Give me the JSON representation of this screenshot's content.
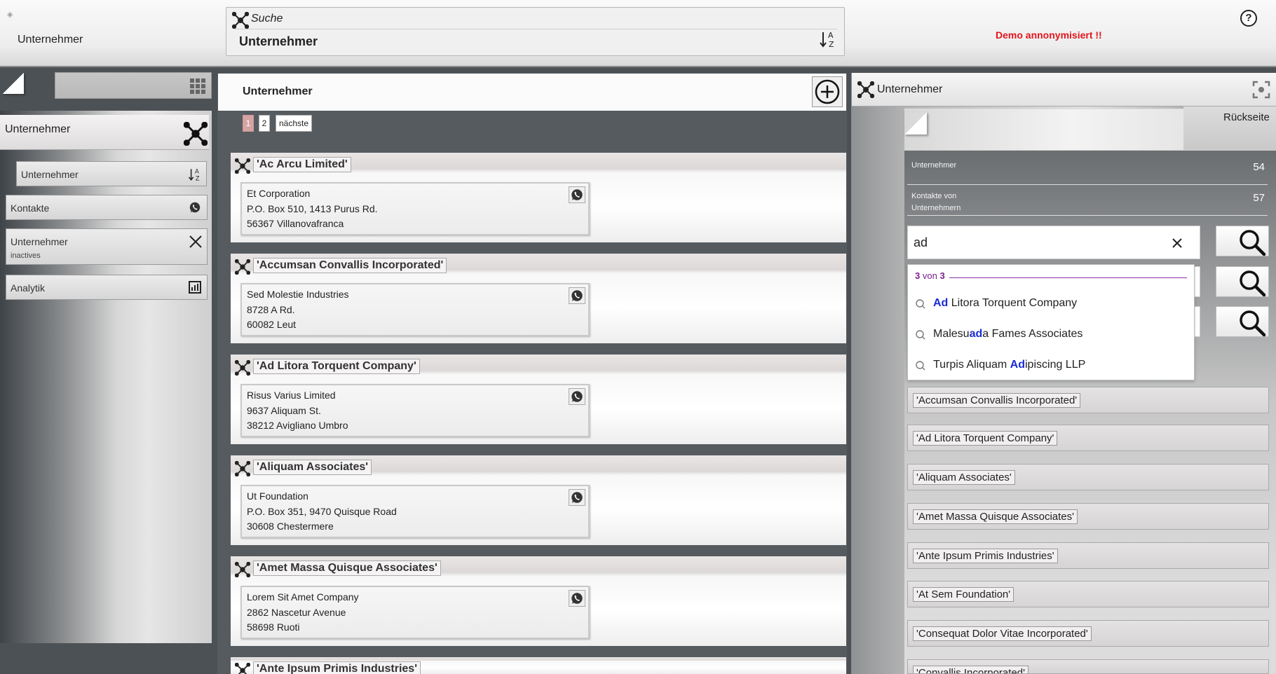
{
  "header": {
    "context_label": "Unternehmer",
    "search_label": "Suche",
    "search_value": "Unternehmer",
    "demo_notice": "Demo annonymisiert !!",
    "help_label": "?"
  },
  "sidebar": {
    "title": "Unternehmer",
    "items": [
      {
        "label": "Unternehmer",
        "sub": "",
        "icon": "sort-az-icon"
      },
      {
        "label": "Kontakte",
        "sub": "",
        "icon": "whatsapp-icon"
      },
      {
        "label": "Unternehmer",
        "sub": "inactives",
        "icon": "close-icon"
      },
      {
        "label": "Analytik",
        "sub": "",
        "icon": "analytics-icon"
      }
    ]
  },
  "main": {
    "title": "Unternehmer",
    "pager": [
      "1",
      "2",
      "nächste"
    ],
    "cards": [
      {
        "title": "'Ac Arcu Limited'",
        "lines": [
          "Et Corporation",
          "P.O. Box 510, 1413 Purus Rd.",
          "56367 Villanovafranca"
        ]
      },
      {
        "title": "'Accumsan Convallis Incorporated'",
        "lines": [
          "Sed Molestie Industries",
          "8728 A Rd.",
          "60082 Leut"
        ]
      },
      {
        "title": "'Ad Litora Torquent Company'",
        "lines": [
          "Risus Varius Limited",
          "9637 Aliquam St.",
          "38212 Avigliano Umbro"
        ]
      },
      {
        "title": "'Aliquam Associates'",
        "lines": [
          "Ut Foundation",
          "P.O. Box 351, 9470 Quisque Road",
          "30608 Chestermere"
        ]
      },
      {
        "title": "'Amet Massa Quisque Associates'",
        "lines": [
          "Lorem Sit Amet Company",
          "2862 Nascetur Avenue",
          "58698 Ruoti"
        ]
      },
      {
        "title": "'Ante Ipsum Primis Industries'",
        "lines": [
          "",
          "",
          ""
        ]
      }
    ]
  },
  "right": {
    "title": "Unternehmer",
    "back_label": "Rückseite",
    "stats": [
      {
        "label": "Unternehmer",
        "value": "54"
      },
      {
        "label": "Kontakte von Unternehmern",
        "value": "57"
      }
    ],
    "search_value": "ad",
    "dropdown": {
      "count_current": "3",
      "count_of": "von",
      "count_total": "3",
      "items": [
        {
          "pre": "",
          "hl": "Ad",
          "post": " Litora Torquent Company"
        },
        {
          "pre": "Malesu",
          "hl": "ad",
          "post": "a Fames Associates"
        },
        {
          "pre": "Turpis Aliquam ",
          "hl": "Ad",
          "post": "ipiscing LLP"
        }
      ]
    },
    "list": [
      "'Accumsan Convallis Incorporated'",
      "'Ad Litora Torquent Company'",
      "'Aliquam Associates'",
      "'Amet Massa Quisque Associates'",
      "'Ante Ipsum Primis Industries'",
      "'At Sem Foundation'",
      "'Consequat Dolor Vitae Incorporated'",
      "'Convallis Incorporated'"
    ]
  },
  "colors": {
    "demo_red": "#e3141b",
    "highlight_blue": "#1a2bd6",
    "count_purple": "#7a1f8f",
    "pager_active": "#d6a3a3"
  }
}
